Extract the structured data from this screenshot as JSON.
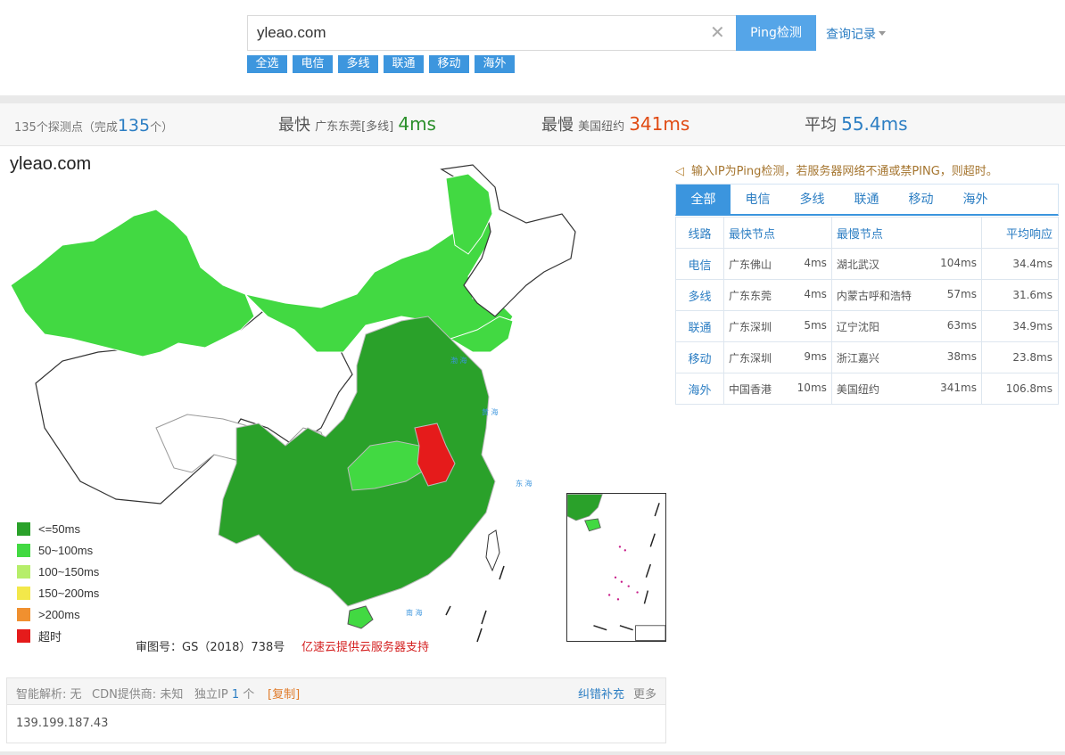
{
  "search": {
    "value": "yleao.com",
    "button": "Ping检测",
    "history": "查询记录"
  },
  "filters": [
    "全选",
    "电信",
    "多线",
    "联通",
    "移动",
    "海外"
  ],
  "summary": {
    "probes_prefix": "135个探测点（完成",
    "probes_done": "135",
    "probes_suffix": "个）",
    "fastest_label": "最快",
    "fastest_node": "广东东莞[多线]",
    "fastest_value": "4ms",
    "slowest_label": "最慢",
    "slowest_node": "美国纽约",
    "slowest_value": "341ms",
    "avg_label": "平均",
    "avg_value": "55.4ms"
  },
  "map": {
    "domain": "yleao.com",
    "approval": "审图号：GS（2018）738号",
    "sponsor": "亿速云提供云服务器支持",
    "legend": [
      {
        "label": "<=50ms",
        "color": "#2aa12a"
      },
      {
        "label": "50~100ms",
        "color": "#42d942"
      },
      {
        "label": "100~150ms",
        "color": "#b6ee6a"
      },
      {
        "label": "150~200ms",
        "color": "#f3e84a"
      },
      {
        "label": ">200ms",
        "color": "#f0902f"
      },
      {
        "label": "超时",
        "color": "#e51b1b"
      }
    ],
    "colors": {
      "fast": "#2aa12a",
      "medium": "#42d942",
      "timeout": "#e51b1b",
      "none": "#ffffff"
    }
  },
  "notice": "输入IP为Ping检测，若服务器网络不通或禁PING，则超时。",
  "tabs": [
    "全部",
    "电信",
    "多线",
    "联通",
    "移动",
    "海外"
  ],
  "table": {
    "headers": {
      "line": "线路",
      "fastest": "最快节点",
      "slowest": "最慢节点",
      "avg": "平均响应"
    },
    "rows": [
      {
        "line": "电信",
        "fast_node": "广东佛山",
        "fast_ms": "4ms",
        "slow_node": "湖北武汉",
        "slow_ms": "104ms",
        "avg": "34.4ms"
      },
      {
        "line": "多线",
        "fast_node": "广东东莞",
        "fast_ms": "4ms",
        "slow_node": "内蒙古呼和浩特",
        "slow_ms": "57ms",
        "avg": "31.6ms"
      },
      {
        "line": "联通",
        "fast_node": "广东深圳",
        "fast_ms": "5ms",
        "slow_node": "辽宁沈阳",
        "slow_ms": "63ms",
        "avg": "34.9ms"
      },
      {
        "line": "移动",
        "fast_node": "广东深圳",
        "fast_ms": "9ms",
        "slow_node": "浙江嘉兴",
        "slow_ms": "38ms",
        "avg": "23.8ms"
      },
      {
        "line": "海外",
        "fast_node": "中国香港",
        "fast_ms": "10ms",
        "slow_node": "美国纽约",
        "slow_ms": "341ms",
        "avg": "106.8ms"
      }
    ]
  },
  "info": {
    "dns_label": "智能解析: 无",
    "cdn_label": "CDN提供商: 未知",
    "ip_label": "独立IP",
    "ip_count": "1",
    "ip_unit": "个",
    "copy": "[复制]",
    "correct": "纠错补充",
    "more": "更多",
    "ip": "139.199.187.43"
  }
}
